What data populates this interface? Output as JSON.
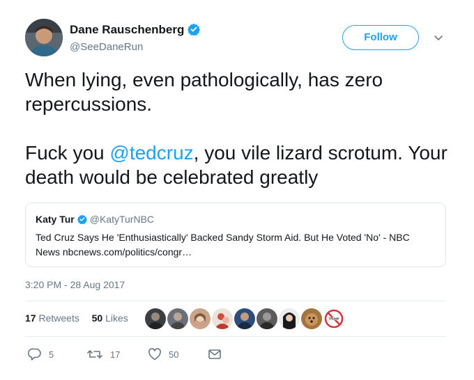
{
  "author": {
    "name": "Dane Rauschenberg",
    "handle": "@SeeDaneRun",
    "verified_icon": "verified-badge-icon"
  },
  "follow_button": {
    "label": "Follow"
  },
  "tweet": {
    "line1": "When lying, even pathologically, has zero repercussions.",
    "line2_prefix": "Fuck you ",
    "mention": "@tedcruz",
    "line2_suffix": ", you vile lizard scrotum. Your death would be celebrated greatly"
  },
  "quoted_tweet": {
    "author_name": "Katy Tur",
    "author_handle": "@KatyTurNBC",
    "text": "Ted Cruz Says He 'Enthusiastically' Backed Sandy Storm Aid. But He Voted 'No' - NBC News nbcnews.com/politics/congr…"
  },
  "timestamp": "3:20 PM - 28 Aug 2017",
  "stats": {
    "retweets_count": "17",
    "retweets_label": "Retweets",
    "likes_count": "50",
    "likes_label": "Likes"
  },
  "likers": [
    {
      "color": "#3b3f44"
    },
    {
      "color": "#6b6f78"
    },
    {
      "color": "#caa38a"
    },
    {
      "color": "#d14a3c"
    },
    {
      "color": "#2d4d7a"
    },
    {
      "color": "#5c5c5c"
    },
    {
      "color": "#1a1a1a"
    },
    {
      "color": "#a4743e"
    },
    {
      "color": "#d6333a"
    }
  ],
  "actions": {
    "reply_count": "5",
    "retweet_count": "17",
    "like_count": "50"
  },
  "colors": {
    "accent": "#1da1f2",
    "text": "#14171a",
    "secondary": "#657786",
    "border": "#e1e8ed"
  }
}
